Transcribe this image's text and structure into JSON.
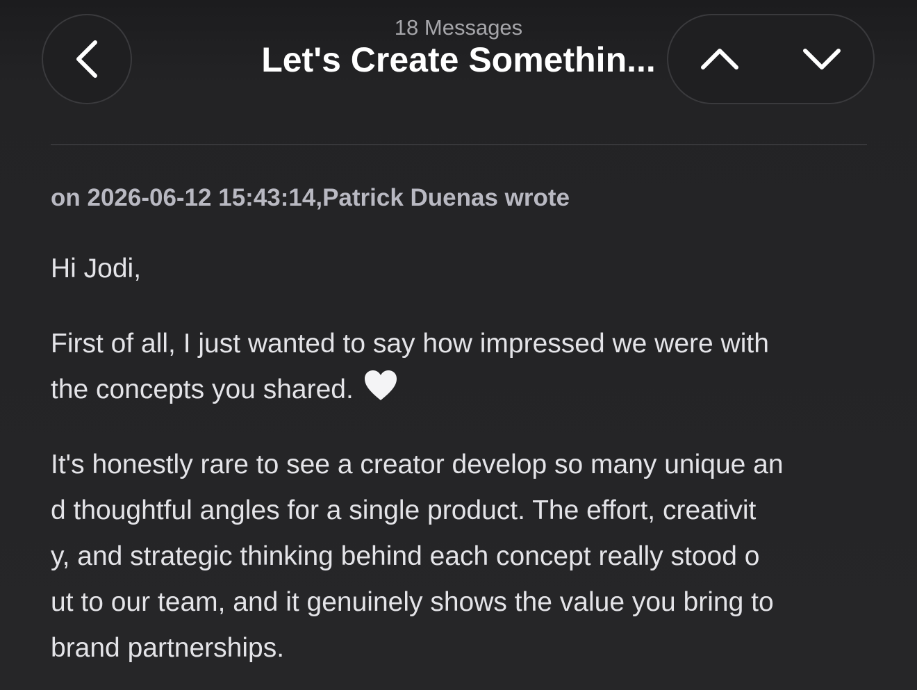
{
  "header": {
    "message_count": "18 Messages",
    "title": "Let's Create Somethin...",
    "back_icon": "chevron-left-icon",
    "prev_icon": "chevron-up-icon",
    "next_icon": "chevron-down-icon"
  },
  "message": {
    "quote_header": "on 2026-06-12 15:43:14,Patrick Duenas wrote",
    "greeting": "Hi Jodi,",
    "paragraph_1_line_1": "First of all, I just wanted to say how impressed we were with",
    "paragraph_1_line_2": "the concepts you shared.",
    "heart_icon": "white-heart-icon",
    "paragraph_2_lines": [
      "It's honestly rare to see a creator develop so many unique an",
      "d thoughtful angles for a single product. The effort, creativit",
      "y, and strategic thinking behind each concept really stood o",
      "ut to our team, and it genuinely shows the value you bring to",
      "brand partnerships."
    ]
  },
  "colors": {
    "background": "#232325",
    "title_text": "#ffffff",
    "body_text": "#e4e4e8",
    "muted_text": "#a6a6aa",
    "button_border": "#3a3a3d"
  }
}
